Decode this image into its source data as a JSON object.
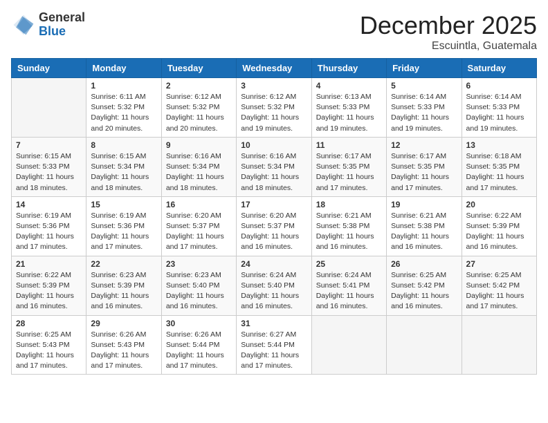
{
  "logo": {
    "general": "General",
    "blue": "Blue"
  },
  "title": "December 2025",
  "location": "Escuintla, Guatemala",
  "days_of_week": [
    "Sunday",
    "Monday",
    "Tuesday",
    "Wednesday",
    "Thursday",
    "Friday",
    "Saturday"
  ],
  "weeks": [
    [
      {
        "day": "",
        "info": ""
      },
      {
        "day": "1",
        "info": "Sunrise: 6:11 AM\nSunset: 5:32 PM\nDaylight: 11 hours\nand 20 minutes."
      },
      {
        "day": "2",
        "info": "Sunrise: 6:12 AM\nSunset: 5:32 PM\nDaylight: 11 hours\nand 20 minutes."
      },
      {
        "day": "3",
        "info": "Sunrise: 6:12 AM\nSunset: 5:32 PM\nDaylight: 11 hours\nand 19 minutes."
      },
      {
        "day": "4",
        "info": "Sunrise: 6:13 AM\nSunset: 5:33 PM\nDaylight: 11 hours\nand 19 minutes."
      },
      {
        "day": "5",
        "info": "Sunrise: 6:14 AM\nSunset: 5:33 PM\nDaylight: 11 hours\nand 19 minutes."
      },
      {
        "day": "6",
        "info": "Sunrise: 6:14 AM\nSunset: 5:33 PM\nDaylight: 11 hours\nand 19 minutes."
      }
    ],
    [
      {
        "day": "7",
        "info": "Sunrise: 6:15 AM\nSunset: 5:33 PM\nDaylight: 11 hours\nand 18 minutes."
      },
      {
        "day": "8",
        "info": "Sunrise: 6:15 AM\nSunset: 5:34 PM\nDaylight: 11 hours\nand 18 minutes."
      },
      {
        "day": "9",
        "info": "Sunrise: 6:16 AM\nSunset: 5:34 PM\nDaylight: 11 hours\nand 18 minutes."
      },
      {
        "day": "10",
        "info": "Sunrise: 6:16 AM\nSunset: 5:34 PM\nDaylight: 11 hours\nand 18 minutes."
      },
      {
        "day": "11",
        "info": "Sunrise: 6:17 AM\nSunset: 5:35 PM\nDaylight: 11 hours\nand 17 minutes."
      },
      {
        "day": "12",
        "info": "Sunrise: 6:17 AM\nSunset: 5:35 PM\nDaylight: 11 hours\nand 17 minutes."
      },
      {
        "day": "13",
        "info": "Sunrise: 6:18 AM\nSunset: 5:35 PM\nDaylight: 11 hours\nand 17 minutes."
      }
    ],
    [
      {
        "day": "14",
        "info": "Sunrise: 6:19 AM\nSunset: 5:36 PM\nDaylight: 11 hours\nand 17 minutes."
      },
      {
        "day": "15",
        "info": "Sunrise: 6:19 AM\nSunset: 5:36 PM\nDaylight: 11 hours\nand 17 minutes."
      },
      {
        "day": "16",
        "info": "Sunrise: 6:20 AM\nSunset: 5:37 PM\nDaylight: 11 hours\nand 17 minutes."
      },
      {
        "day": "17",
        "info": "Sunrise: 6:20 AM\nSunset: 5:37 PM\nDaylight: 11 hours\nand 16 minutes."
      },
      {
        "day": "18",
        "info": "Sunrise: 6:21 AM\nSunset: 5:38 PM\nDaylight: 11 hours\nand 16 minutes."
      },
      {
        "day": "19",
        "info": "Sunrise: 6:21 AM\nSunset: 5:38 PM\nDaylight: 11 hours\nand 16 minutes."
      },
      {
        "day": "20",
        "info": "Sunrise: 6:22 AM\nSunset: 5:39 PM\nDaylight: 11 hours\nand 16 minutes."
      }
    ],
    [
      {
        "day": "21",
        "info": "Sunrise: 6:22 AM\nSunset: 5:39 PM\nDaylight: 11 hours\nand 16 minutes."
      },
      {
        "day": "22",
        "info": "Sunrise: 6:23 AM\nSunset: 5:39 PM\nDaylight: 11 hours\nand 16 minutes."
      },
      {
        "day": "23",
        "info": "Sunrise: 6:23 AM\nSunset: 5:40 PM\nDaylight: 11 hours\nand 16 minutes."
      },
      {
        "day": "24",
        "info": "Sunrise: 6:24 AM\nSunset: 5:40 PM\nDaylight: 11 hours\nand 16 minutes."
      },
      {
        "day": "25",
        "info": "Sunrise: 6:24 AM\nSunset: 5:41 PM\nDaylight: 11 hours\nand 16 minutes."
      },
      {
        "day": "26",
        "info": "Sunrise: 6:25 AM\nSunset: 5:42 PM\nDaylight: 11 hours\nand 16 minutes."
      },
      {
        "day": "27",
        "info": "Sunrise: 6:25 AM\nSunset: 5:42 PM\nDaylight: 11 hours\nand 17 minutes."
      }
    ],
    [
      {
        "day": "28",
        "info": "Sunrise: 6:25 AM\nSunset: 5:43 PM\nDaylight: 11 hours\nand 17 minutes."
      },
      {
        "day": "29",
        "info": "Sunrise: 6:26 AM\nSunset: 5:43 PM\nDaylight: 11 hours\nand 17 minutes."
      },
      {
        "day": "30",
        "info": "Sunrise: 6:26 AM\nSunset: 5:44 PM\nDaylight: 11 hours\nand 17 minutes."
      },
      {
        "day": "31",
        "info": "Sunrise: 6:27 AM\nSunset: 5:44 PM\nDaylight: 11 hours\nand 17 minutes."
      },
      {
        "day": "",
        "info": ""
      },
      {
        "day": "",
        "info": ""
      },
      {
        "day": "",
        "info": ""
      }
    ]
  ]
}
